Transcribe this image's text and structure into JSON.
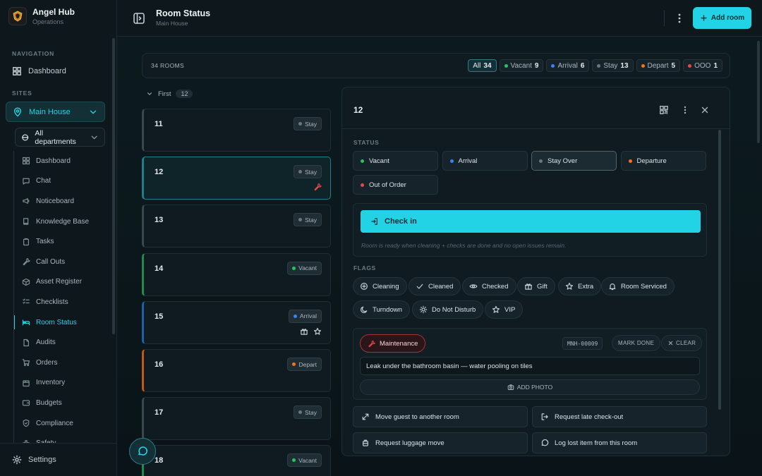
{
  "brand": {
    "name": "Angel Hub",
    "subtitle": "Operations"
  },
  "nav_label": "NAVIGATION",
  "nav_dashboard": "Dashboard",
  "sites_label": "SITES",
  "site": "Main House",
  "department": "All departments",
  "subnav": [
    {
      "label": "Dashboard",
      "icon": "grid-icon"
    },
    {
      "label": "Chat",
      "icon": "chat-icon"
    },
    {
      "label": "Noticeboard",
      "icon": "megaphone-icon"
    },
    {
      "label": "Knowledge Base",
      "icon": "book-icon"
    },
    {
      "label": "Tasks",
      "icon": "clipboard-icon"
    },
    {
      "label": "Call Outs",
      "icon": "wrench-icon"
    },
    {
      "label": "Asset Register",
      "icon": "box-icon"
    },
    {
      "label": "Checklists",
      "icon": "checklist-icon"
    },
    {
      "label": "Room Status",
      "icon": "bed-icon",
      "active": true
    },
    {
      "label": "Audits",
      "icon": "doc-icon"
    },
    {
      "label": "Orders",
      "icon": "cart-icon"
    },
    {
      "label": "Inventory",
      "icon": "package-icon"
    },
    {
      "label": "Budgets",
      "icon": "wallet-icon"
    },
    {
      "label": "Compliance",
      "icon": "shield-icon"
    },
    {
      "label": "Safety",
      "icon": "cross-icon"
    }
  ],
  "settings": "Settings",
  "header": {
    "title": "Room Status",
    "subtitle": "Main House",
    "add_room": "Add room"
  },
  "summary": {
    "count": "34 ROOMS",
    "filters": [
      {
        "label": "All",
        "count": "34",
        "active": true
      },
      {
        "label": "Vacant",
        "count": "9",
        "color": "#22c55e"
      },
      {
        "label": "Arrival",
        "count": "6",
        "color": "#3b82f6"
      },
      {
        "label": "Stay",
        "count": "13",
        "color": "#6b7780"
      },
      {
        "label": "Depart",
        "count": "5",
        "color": "#f97316"
      },
      {
        "label": "OOO",
        "count": "1",
        "color": "#ef4444"
      }
    ]
  },
  "group": {
    "name": "First",
    "count": "12"
  },
  "rooms": [
    {
      "number": "11",
      "status": "Stay",
      "color": "#6b7780",
      "border": "#3a4850"
    },
    {
      "number": "12",
      "status": "Stay",
      "color": "#6b7780",
      "border": "#1f7f88",
      "selected": true,
      "icons": [
        "wrench-icon"
      ]
    },
    {
      "number": "13",
      "status": "Stay",
      "color": "#6b7780",
      "border": "#3a4850"
    },
    {
      "number": "14",
      "status": "Vacant",
      "color": "#22c55e",
      "border": "#1f8a4c"
    },
    {
      "number": "15",
      "status": "Arrival",
      "color": "#3b82f6",
      "border": "#1d5fa8",
      "icons": [
        "gift-icon",
        "star-icon"
      ]
    },
    {
      "number": "16",
      "status": "Depart",
      "color": "#f97316",
      "border": "#c25a14"
    },
    {
      "number": "17",
      "status": "Stay",
      "color": "#6b7780",
      "border": "#3a4850"
    },
    {
      "number": "18",
      "status": "Vacant",
      "color": "#22c55e",
      "border": "#1f8a4c"
    }
  ],
  "detail": {
    "title": "12",
    "status_label": "STATUS",
    "statuses": [
      {
        "label": "Vacant",
        "color": "#22c55e"
      },
      {
        "label": "Arrival",
        "color": "#3b82f6"
      },
      {
        "label": "Stay Over",
        "color": "#6b7780",
        "active": true
      },
      {
        "label": "Departure",
        "color": "#f97316"
      },
      {
        "label": "Out of Order",
        "color": "#ef4444"
      }
    ],
    "checkin": "Check in",
    "checkin_note": "Room is ready when cleaning + checks are done and no open issues remain.",
    "flags_label": "FLAGS",
    "flags": [
      {
        "label": "Cleaning",
        "icon": "plus-circle-icon"
      },
      {
        "label": "Cleaned",
        "icon": "check-icon"
      },
      {
        "label": "Checked",
        "icon": "eye-icon"
      },
      {
        "label": "Gift",
        "icon": "gift-icon"
      },
      {
        "label": "Extra",
        "icon": "star-icon"
      },
      {
        "label": "Room Serviced",
        "icon": "bell-icon"
      },
      {
        "label": "Turndown",
        "icon": "moon-icon"
      },
      {
        "label": "Do Not Disturb",
        "icon": "sun-icon"
      },
      {
        "label": "VIP",
        "icon": "star-icon"
      }
    ],
    "maintenance": {
      "label": "Maintenance",
      "id": "MNH-00009",
      "mark_done": "MARK DONE",
      "clear": "CLEAR",
      "note": "Leak under the bathroom basin — water pooling on tiles",
      "add_photo": "ADD PHOTO"
    },
    "actions": [
      {
        "label": "Move guest to another room",
        "icon": "move-icon"
      },
      {
        "label": "Request late check-out",
        "icon": "logout-icon"
      },
      {
        "label": "Request luggage move",
        "icon": "luggage-icon"
      },
      {
        "label": "Log lost item from this room",
        "icon": "message-icon"
      }
    ]
  }
}
